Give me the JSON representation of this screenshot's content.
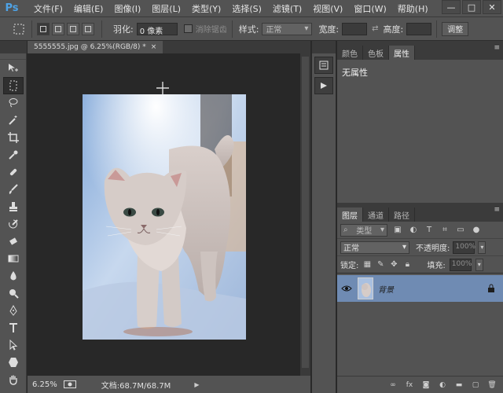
{
  "app": {
    "logo": "Ps"
  },
  "menu": [
    "文件(F)",
    "编辑(E)",
    "图像(I)",
    "图层(L)",
    "类型(Y)",
    "选择(S)",
    "滤镜(T)",
    "视图(V)",
    "窗口(W)",
    "帮助(H)"
  ],
  "window_controls": {
    "minimize": "—",
    "maximize": "□",
    "close": "✕"
  },
  "options": {
    "feather_label": "羽化:",
    "feather_value": "0 像素",
    "antialias_label": "消除锯齿",
    "style_label": "样式:",
    "style_value": "正常",
    "width_label": "宽度:",
    "height_label": "高度:",
    "adjust_button": "调整"
  },
  "document": {
    "tab_title": "5555555.jpg @ 6.25%(RGB/8) *",
    "close": "×",
    "zoom": "6.25%",
    "doc_info": "文档:68.7M/68.7M"
  },
  "panels_top": {
    "tabs": [
      "颜色",
      "色板",
      "属性"
    ],
    "active_tab": 2,
    "properties_text": "无属性"
  },
  "layers": {
    "tabs": [
      "图层",
      "通道",
      "路径"
    ],
    "active_tab": 0,
    "filter_select": "类型",
    "blend_mode": "正常",
    "opacity_label": "不透明度:",
    "opacity_value": "100%",
    "lock_label": "锁定:",
    "fill_label": "填充:",
    "fill_value": "100%",
    "layer_name": "背景"
  },
  "colors": {
    "accent": "#4ea3e6",
    "layer_selected": "#6f8bb3",
    "panel": "#535353",
    "canvas": "#282828"
  }
}
